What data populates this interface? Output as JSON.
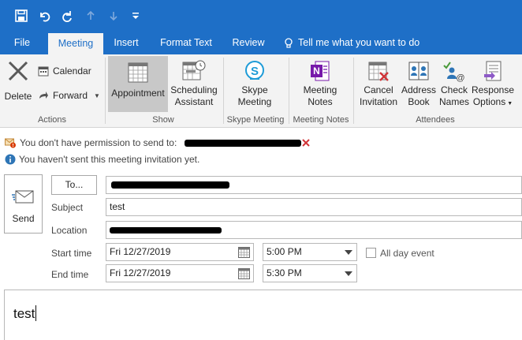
{
  "quick_access": {
    "save_icon": "save-icon",
    "undo_icon": "undo-icon",
    "redo_icon": "redo-icon",
    "up_icon": "arrow-up-icon",
    "down_icon": "arrow-down-icon",
    "customize_icon": "customize-qat-icon"
  },
  "tabs": [
    {
      "label": "File"
    },
    {
      "label": "Meeting"
    },
    {
      "label": "Insert"
    },
    {
      "label": "Format Text"
    },
    {
      "label": "Review"
    }
  ],
  "tell_me": "Tell me what you want to do",
  "ribbon": {
    "actions": {
      "delete": "Delete",
      "calendar": "Calendar",
      "forward": "Forward",
      "group": "Actions"
    },
    "show": {
      "appointment": "Appointment",
      "scheduling_line1": "Scheduling",
      "scheduling_line2": "Assistant",
      "group": "Show"
    },
    "skype": {
      "line1": "Skype",
      "line2": "Meeting",
      "group": "Skype Meeting"
    },
    "notes": {
      "line1": "Meeting",
      "line2": "Notes",
      "group": "Meeting Notes"
    },
    "attendees": {
      "cancel_line1": "Cancel",
      "cancel_line2": "Invitation",
      "address_line1": "Address",
      "address_line2": "Book",
      "check_line1": "Check",
      "check_line2": "Names",
      "response_line1": "Response",
      "response_line2": "Options",
      "group": "Attendees"
    }
  },
  "infobar": {
    "permission": "You don't have permission to send to:",
    "not_sent": "You haven't sent this meeting invitation yet."
  },
  "form": {
    "send": "Send",
    "to": "To...",
    "subject_label": "Subject",
    "subject_value": "test",
    "location_label": "Location",
    "start_label": "Start time",
    "start_date": "Fri 12/27/2019",
    "start_time": "5:00 PM",
    "all_day": "All day event",
    "end_label": "End time",
    "end_date": "Fri 12/27/2019",
    "end_time": "5:30 PM"
  },
  "body": {
    "text": "test"
  },
  "colors": {
    "brand": "#1e6fc7",
    "ribbon": "#f3f3f3",
    "pressed": "#c8c8c8"
  }
}
